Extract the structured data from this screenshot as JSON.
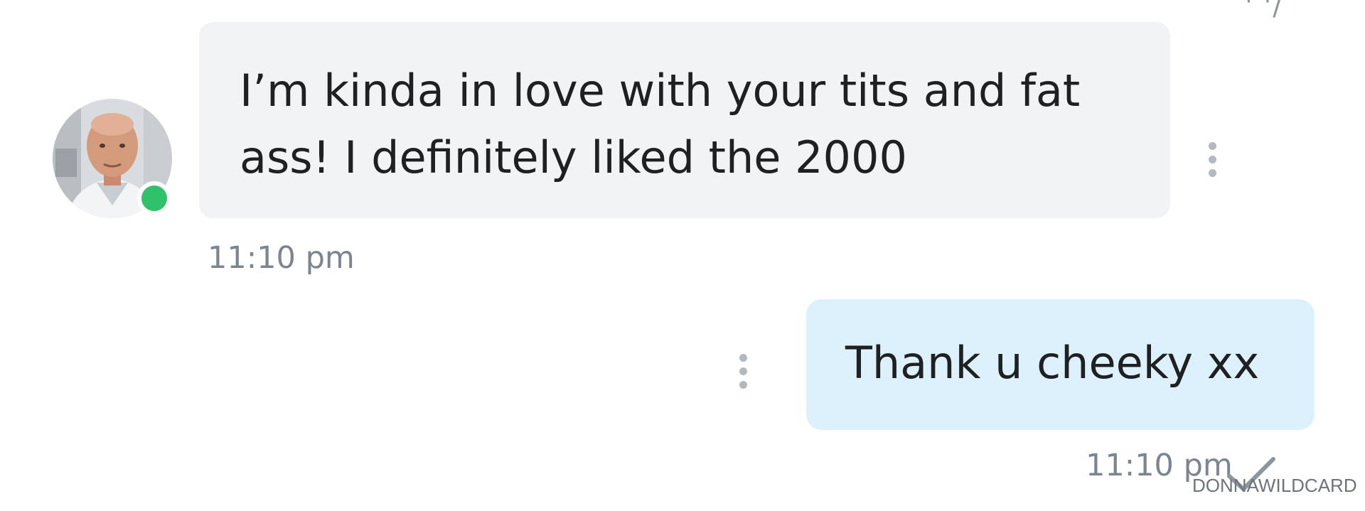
{
  "conversation": {
    "messages": [
      {
        "direction": "incoming",
        "text": "I’m kinda in love with your tits and fat\nass! I definitely liked the 2000",
        "time": "11:10 pm",
        "sender_online": true
      },
      {
        "direction": "outgoing",
        "text": "Thank u cheeky xx",
        "time": "11:10 pm",
        "status_icon": "check-icon"
      }
    ]
  },
  "watermark": "DONNAWILDCARD",
  "colors": {
    "incoming_bubble": "#f1f3f4",
    "outgoing_bubble": "#dcf1fb",
    "online_indicator": "#2fc26b",
    "timestamp": "#7b8590",
    "menu_dots": "#b4b9bd"
  },
  "icons": {
    "message_menu": "more-vertical-icon",
    "delivery_status": "check-icon"
  }
}
